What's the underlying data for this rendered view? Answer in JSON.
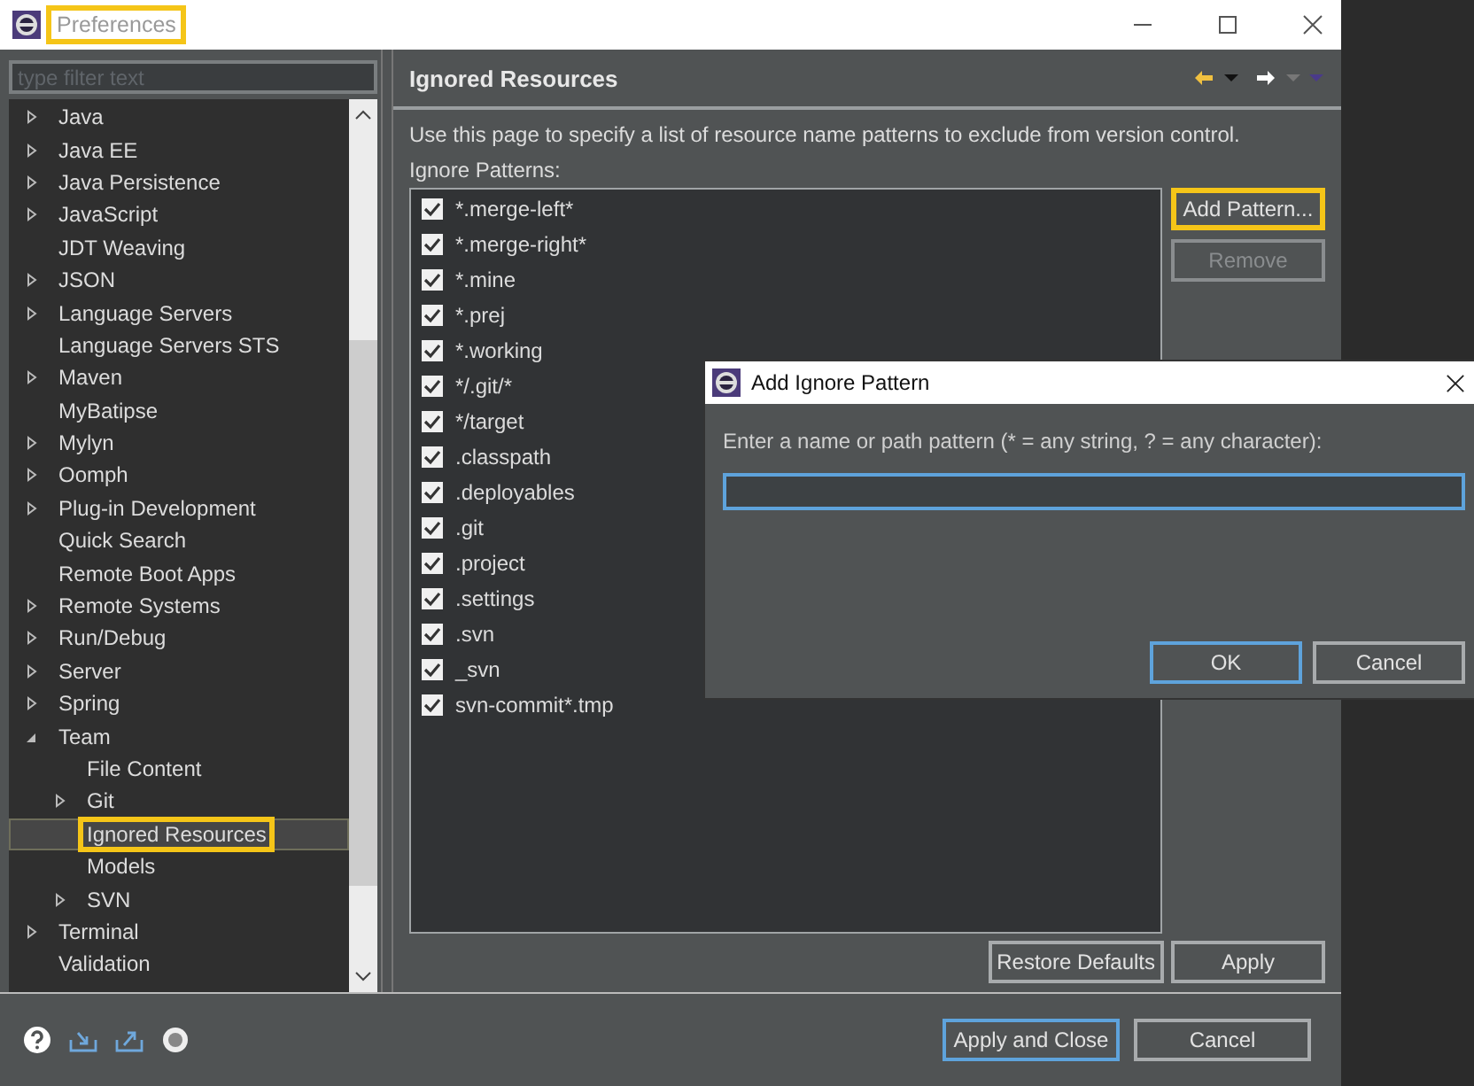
{
  "window": {
    "title": "Preferences",
    "highlighted": true
  },
  "filter": {
    "placeholder": "type filter text"
  },
  "tree": [
    {
      "label": "Java",
      "expanded": false,
      "selected": false
    },
    {
      "label": "Java EE",
      "expanded": false,
      "selected": false
    },
    {
      "label": "Java Persistence",
      "expanded": false,
      "selected": false
    },
    {
      "label": "JavaScript",
      "expanded": false,
      "selected": false
    },
    {
      "label": "JDT Weaving",
      "selected": false
    },
    {
      "label": "JSON",
      "expanded": false,
      "selected": false
    },
    {
      "label": "Language Servers",
      "expanded": false,
      "selected": false
    },
    {
      "label": "Language Servers STS",
      "selected": false
    },
    {
      "label": "Maven",
      "expanded": false,
      "selected": false
    },
    {
      "label": "MyBatipse",
      "selected": false
    },
    {
      "label": "Mylyn",
      "expanded": false,
      "selected": false
    },
    {
      "label": "Oomph",
      "expanded": false,
      "selected": false
    },
    {
      "label": "Plug-in Development",
      "expanded": false,
      "selected": false
    },
    {
      "label": "Quick Search",
      "selected": false
    },
    {
      "label": "Remote Boot Apps",
      "selected": false
    },
    {
      "label": "Remote Systems",
      "expanded": false,
      "selected": false
    },
    {
      "label": "Run/Debug",
      "expanded": false,
      "selected": false
    },
    {
      "label": "Server",
      "expanded": false,
      "selected": false
    },
    {
      "label": "Spring",
      "expanded": false,
      "selected": false
    },
    {
      "label": "Team",
      "expanded": true,
      "selected": false,
      "children": [
        {
          "label": "File Content",
          "selected": false
        },
        {
          "label": "Git",
          "expanded": false,
          "selected": false
        },
        {
          "label": "Ignored Resources",
          "selected": true,
          "highlighted": true
        },
        {
          "label": "Models",
          "selected": false
        },
        {
          "label": "SVN",
          "expanded": false,
          "selected": false
        }
      ]
    },
    {
      "label": "Terminal",
      "expanded": false,
      "selected": false
    },
    {
      "label": "Validation",
      "selected": false
    }
  ],
  "page": {
    "title": "Ignored Resources",
    "description": "Use this page to specify a list of resource name patterns to exclude from version control.",
    "list_label": "Ignore Patterns:",
    "patterns": [
      {
        "label": "*.merge-left*",
        "checked": true
      },
      {
        "label": "*.merge-right*",
        "checked": true
      },
      {
        "label": "*.mine",
        "checked": true
      },
      {
        "label": "*.prej",
        "checked": true
      },
      {
        "label": "*.working",
        "checked": true
      },
      {
        "label": "*/.git/*",
        "checked": true
      },
      {
        "label": "*/target",
        "checked": true
      },
      {
        "label": ".classpath",
        "checked": true
      },
      {
        "label": ".deployables",
        "checked": true
      },
      {
        "label": ".git",
        "checked": true
      },
      {
        "label": ".project",
        "checked": true
      },
      {
        "label": ".settings",
        "checked": true
      },
      {
        "label": ".svn",
        "checked": true
      },
      {
        "label": "_svn",
        "checked": true
      },
      {
        "label": "svn-commit*.tmp",
        "checked": true
      }
    ],
    "side_buttons": [
      {
        "label": "Add Pattern...",
        "disabled": false,
        "highlighted": true
      },
      {
        "label": "Remove",
        "disabled": true,
        "highlighted": false
      }
    ],
    "bottom_buttons": [
      {
        "label": "Restore Defaults"
      },
      {
        "label": "Apply"
      }
    ]
  },
  "footer_buttons": [
    {
      "label": "Apply and Close",
      "default": true
    },
    {
      "label": "Cancel",
      "default": false
    }
  ],
  "dialog": {
    "title": "Add Ignore Pattern",
    "prompt": "Enter a name or path pattern (* = any string, ? = any character):",
    "buttons": [
      {
        "label": "OK",
        "default": true
      },
      {
        "label": "Cancel",
        "default": false
      }
    ]
  }
}
